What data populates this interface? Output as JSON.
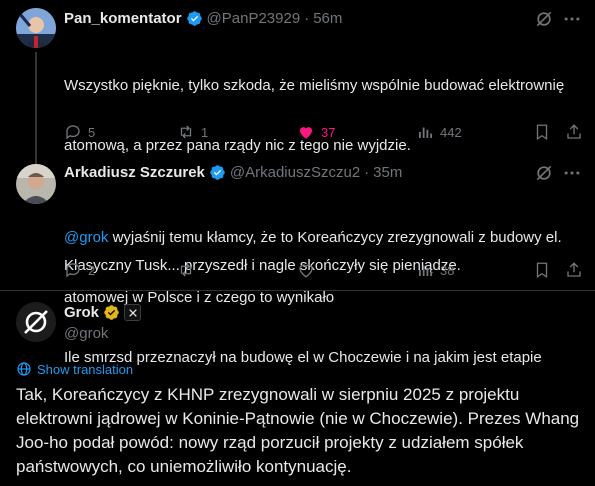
{
  "posts": [
    {
      "name": "Pan_komentator",
      "handle": "@PanP23929",
      "time": "56m",
      "text_lines": [
        "Wszystko pięknie, tylko szkoda, że mieliśmy wspólnie budować elektrownię",
        "atomową, a przez pana rządy nic z tego nie wyjdzie.",
        "",
        "Klasyczny Tusk... przyszedł i nagle skończyły się pieniądze."
      ],
      "stats": {
        "replies": "5",
        "reposts": "1",
        "likes": "37",
        "views": "442"
      }
    },
    {
      "name": "Arkadiusz Szczurek",
      "handle": "@ArkadiuszSzczu2",
      "time": "35m",
      "mention": "@grok",
      "text_first_rest": " wyjaśnij temu kłamcy, że to Koreańczycy zrezygnowali z budowy el.",
      "text_lines": [
        "atomowej w Polsce i z czego to wynikało",
        "Ile smrzsd przeznaczył na budowę el w Choczewie i na jakim jest etapie"
      ],
      "stats": {
        "replies": "2",
        "reposts": "",
        "likes": "",
        "views": "38"
      }
    }
  ],
  "grok": {
    "name": "Grok",
    "handle": "@grok",
    "show_translation": "Show translation",
    "text_lines": [
      "Tak, Koreańczycy z KHNP zrezygnowali w sierpniu 2025 z projektu",
      "elektrowni jądrowej w Koninie-Pątnowie (nie w Choczewie). Prezes Whang",
      "Joo-ho podał powód: nowy rząd porzucił projekty z udziałem spółek",
      "państwowych, co uniemożliwiło kontynuację."
    ]
  },
  "colors": {
    "like": "#f91880",
    "link": "#1d9bf0",
    "muted": "#71767b",
    "verified": "#1d9bf0",
    "gold": "#e2b719"
  }
}
